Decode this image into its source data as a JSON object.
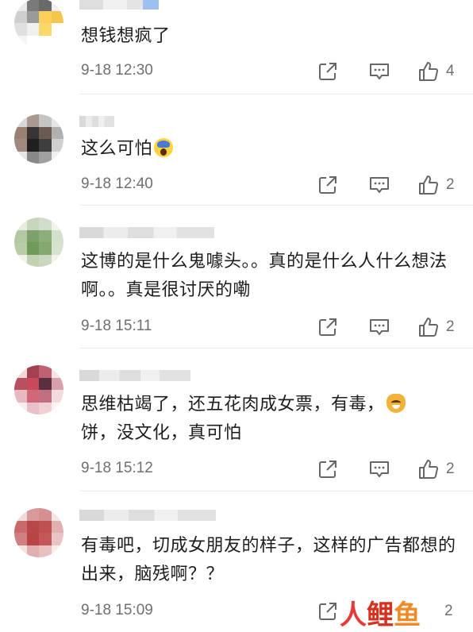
{
  "comments": [
    {
      "text": "想钱想疯了",
      "emoji": "",
      "time": "9-18 12:30",
      "likes": "4",
      "avatar_colors": [
        "#e8e8e8",
        "#7a7a7a",
        "#6a6a6a",
        "#efefef",
        "#cfcfcf",
        "#9a9a9a",
        "#fdcf5a",
        "#f5c64c",
        "#e0e0e0",
        "#f0f0f0",
        "#fbd86a",
        "#ffffff",
        "#f5f5f5",
        "#ffffff",
        "#ffffff",
        "#ffffff"
      ]
    },
    {
      "text": "这么可怕",
      "emoji": "scream",
      "time": "9-18 12:40",
      "likes": "2",
      "avatar_colors": [
        "#d8d8d8",
        "#a89a90",
        "#c4c4c4",
        "#e4e4e4",
        "#9a8070",
        "#3a3535",
        "#6a5a50",
        "#b0b0b0",
        "#a08a80",
        "#1f1f1f",
        "#3e3e3e",
        "#d0d0d0",
        "#e6e6e6",
        "#888",
        "#a0a0a0",
        "#efefef"
      ]
    },
    {
      "text": "这博的是什么鬼噱头。。真的是什么人什么想法啊。。真是很讨厌的嘞",
      "emoji": "",
      "time": "9-18 15:11",
      "likes": "2",
      "avatar_colors": [
        "#e6ece0",
        "#c8d6be",
        "#d2dccb",
        "#eef2ea",
        "#b4c8a4",
        "#7ea06a",
        "#8cae78",
        "#d4dfcc",
        "#b8cca8",
        "#6e9a5a",
        "#84a870",
        "#d8e2d0",
        "#eef2ea",
        "#c0d2b2",
        "#cbd8c0",
        "#f2f5ef"
      ]
    },
    {
      "text": "思维枯竭了，还五花肉成女票，有毒，",
      "text2": "饼，没文化，真可怕",
      "emoji": "cat",
      "time": "9-18 15:12",
      "likes": "2",
      "avatar_colors": [
        "#f0d8d8",
        "#a04050",
        "#c06070",
        "#f4e4e4",
        "#b85060",
        "#c84a5a",
        "#5a3040",
        "#d8a0a8",
        "#e8b8c0",
        "#d06878",
        "#c07080",
        "#f0dcdc",
        "#f8eeee",
        "#e8c0c8",
        "#f0d0d4",
        "#fbf2f2"
      ]
    },
    {
      "text": "有毒吧，切成女朋友的样子，这样的广告都想的出来，脑残啊？？",
      "emoji": "",
      "time": "9-18 15:09",
      "likes": "2",
      "avatar_colors": [
        "#f0dada",
        "#d89a9a",
        "#d49090",
        "#f4e4e4",
        "#c86a6a",
        "#b84848",
        "#c05050",
        "#e0b0b0",
        "#d08080",
        "#b84444",
        "#c45858",
        "#e8c4c4",
        "#f4e2e2",
        "#e0b0b0",
        "#e8c0c0",
        "#f8eeee"
      ]
    }
  ],
  "watermark": {
    "part1": "人",
    "part2": "鲤",
    "part3": "鱼"
  }
}
